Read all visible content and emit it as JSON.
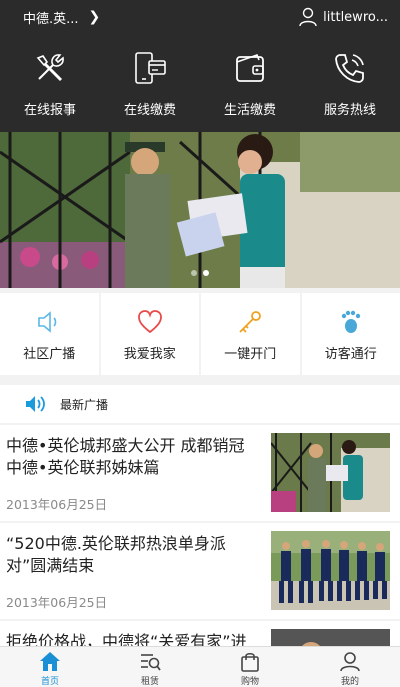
{
  "topbar": {
    "location": "中德.英...",
    "username": "littlewro..."
  },
  "quick_actions": [
    {
      "label": "在线报事",
      "icon": "tools-icon"
    },
    {
      "label": "在线缴费",
      "icon": "phone-card-icon"
    },
    {
      "label": "生活缴费",
      "icon": "wallet-icon"
    },
    {
      "label": "服务热线",
      "icon": "phone-icon"
    }
  ],
  "banner": {
    "slide_count": 2,
    "active_slide": 2
  },
  "services": [
    {
      "label": "社区广播",
      "icon": "speaker-icon",
      "color": "#5bb8e6"
    },
    {
      "label": "我爱我家",
      "icon": "heart-icon",
      "color": "#e84a4a"
    },
    {
      "label": "一键开门",
      "icon": "key-icon",
      "color": "#f0a020"
    },
    {
      "label": "访客通行",
      "icon": "footprint-icon",
      "color": "#4aa8d8"
    }
  ],
  "news_header": {
    "label": "最新广播",
    "icon": "speaker-icon",
    "color": "#1a9bdc"
  },
  "news": [
    {
      "title": "中德•英伦城邦盛大公开 成都销冠中德•英伦联邦姊妹篇",
      "date": "2013年06月25日"
    },
    {
      "title": "“520中德.英伦联邦热浪单身派对”圆满结束",
      "date": "2013年06月25日"
    },
    {
      "title": "拒绝价格战，中德将“关爱有家”进",
      "date": ""
    }
  ],
  "tabs": [
    {
      "label": "首页",
      "icon": "home-icon",
      "active": true
    },
    {
      "label": "租赁",
      "icon": "search-list-icon",
      "active": false
    },
    {
      "label": "购物",
      "icon": "shopping-bag-icon",
      "active": false
    },
    {
      "label": "我的",
      "icon": "user-icon",
      "active": false
    }
  ],
  "colors": {
    "header_bg": "#2b2b2b",
    "accent": "#1a8fd6",
    "page_bg": "#f2f2f2"
  }
}
